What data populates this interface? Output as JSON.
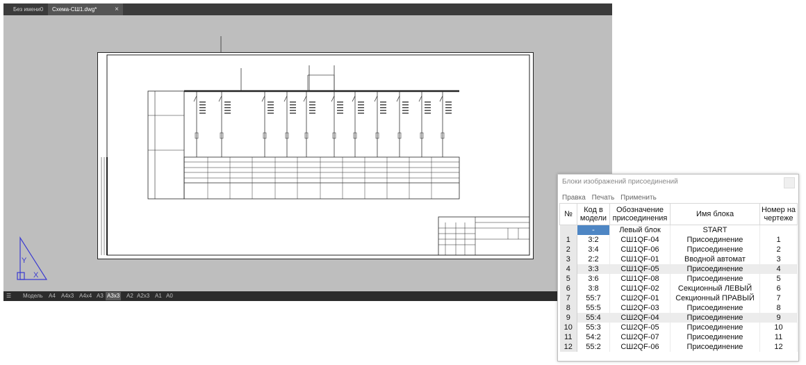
{
  "cad": {
    "tabs": [
      "Без имени0",
      "Схема-СШ1.dwg*"
    ],
    "close_glyph": "×",
    "layout_tabs": [
      "Модель",
      "A4",
      "A4x3",
      "A4x4",
      "A3",
      "A3x3",
      "A2",
      "A2x3",
      "A1",
      "A0"
    ],
    "active_layout": "A3x3",
    "ucs_labels": {
      "y": "Y",
      "x": "X"
    }
  },
  "dialog": {
    "title": "Блоки изображений присоединений",
    "menu": [
      "Правка",
      "Печать",
      "Применить"
    ],
    "columns": [
      "№",
      "Код в модели",
      "Обозначение присоединения",
      "Имя блока",
      "Номер на чертеже"
    ],
    "rows": [
      {
        "n": "",
        "code": "-",
        "designation": "Левый блок",
        "block": "START",
        "sheet_no": ""
      },
      {
        "n": "1",
        "code": "3:2",
        "designation": "СШ1QF-04",
        "block": "Присоединение",
        "sheet_no": "1"
      },
      {
        "n": "2",
        "code": "3:4",
        "designation": "СШ1QF-06",
        "block": "Присоединение",
        "sheet_no": "2"
      },
      {
        "n": "3",
        "code": "2:2",
        "designation": "СШ1QF-01",
        "block": "Вводной автомат",
        "sheet_no": "3"
      },
      {
        "n": "4",
        "code": "3:3",
        "designation": "СШ1QF-05",
        "block": "Присоединение",
        "sheet_no": "4"
      },
      {
        "n": "5",
        "code": "3:6",
        "designation": "СШ1QF-08",
        "block": "Присоединение",
        "sheet_no": "5"
      },
      {
        "n": "6",
        "code": "3:8",
        "designation": "СШ1QF-02",
        "block": "Секционный ЛЕВЫЙ",
        "sheet_no": "6"
      },
      {
        "n": "7",
        "code": "55:7",
        "designation": "СШ2QF-01",
        "block": "Секционный ПРАВЫЙ",
        "sheet_no": "7"
      },
      {
        "n": "8",
        "code": "55:5",
        "designation": "СШ2QF-03",
        "block": "Присоединение",
        "sheet_no": "8"
      },
      {
        "n": "9",
        "code": "55:4",
        "designation": "СШ2QF-04",
        "block": "Присоединение",
        "sheet_no": "9"
      },
      {
        "n": "10",
        "code": "55:3",
        "designation": "СШ2QF-05",
        "block": "Присоединение",
        "sheet_no": "10"
      },
      {
        "n": "11",
        "code": "54:2",
        "designation": "СШ2QF-07",
        "block": "Присоединение",
        "sheet_no": "11"
      },
      {
        "n": "12",
        "code": "55:2",
        "designation": "СШ2QF-06",
        "block": "Присоединение",
        "sheet_no": "12"
      }
    ],
    "selected_row": 0,
    "alternate_rows": [
      4,
      9
    ]
  },
  "colors": {
    "selection": "#4e86c4",
    "ucs_icon": "#3b3bd0",
    "canvas": "#bebebe",
    "tab_bar": "#3b3b3b"
  }
}
